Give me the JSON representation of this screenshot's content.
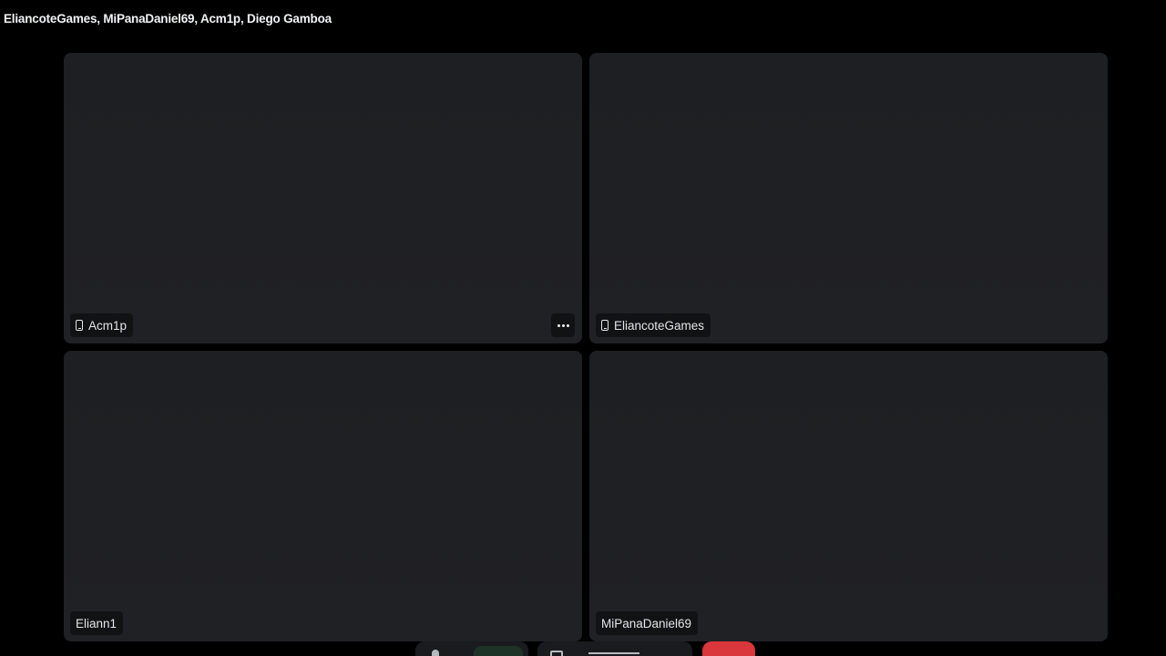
{
  "header": {
    "title": "EliancoteGames, MiPanaDaniel69, Acm1p, Diego Gamboa"
  },
  "participants": [
    {
      "name": "Acm1p",
      "icon": "mobile-phone-icon",
      "has_more_menu": true
    },
    {
      "name": "EliancoteGames",
      "icon": "mobile-phone-icon",
      "has_more_menu": false
    },
    {
      "name": "Eliann1",
      "icon": null,
      "has_more_menu": false
    },
    {
      "name": "MiPanaDaniel69",
      "icon": null,
      "has_more_menu": false
    }
  ],
  "controls": {
    "microphone_icon": "microphone-icon",
    "camera_icon": "camera-icon",
    "leave_icon": "disconnect-icon"
  },
  "colors": {
    "background": "#000000",
    "tile": "#1e1f22",
    "leave": "#da373c",
    "mic_active": "#1e3328"
  }
}
